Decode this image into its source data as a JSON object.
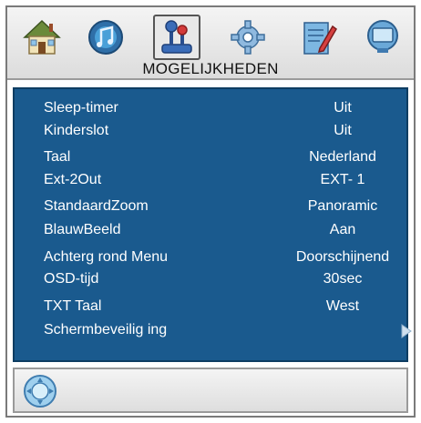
{
  "header": {
    "title": "MOGELIJKHEDEN",
    "icons": [
      {
        "name": "home-icon"
      },
      {
        "name": "sound-icon"
      },
      {
        "name": "options-joystick-icon",
        "selected": true
      },
      {
        "name": "settings-gear-icon"
      },
      {
        "name": "edit-notepad-icon"
      },
      {
        "name": "source-monitor-icon"
      }
    ]
  },
  "settings": {
    "rows": [
      {
        "label": "Sleep-timer",
        "value": "Uit"
      },
      {
        "label": "Kinderslot",
        "value": "Uit"
      },
      {
        "label": "Taal",
        "value": "Nederland"
      },
      {
        "label": "Ext-2Out",
        "value": "EXT- 1"
      },
      {
        "label": "StandaardZoom",
        "value": "Panoramic"
      },
      {
        "label": "BlauwBeeld",
        "value": "Aan"
      },
      {
        "label": "Achterg rond Menu",
        "value": "Doorschijnend"
      },
      {
        "label": "OSD-tijd",
        "value": "30sec"
      },
      {
        "label": "TXT Taal",
        "value": "West"
      },
      {
        "label": "Schermbeveilig ing",
        "value": ""
      }
    ]
  },
  "footer": {
    "icon": "navigation-circle-icon"
  },
  "colors": {
    "panel_bg": "#1a5a8e",
    "panel_text": "#ffffff",
    "arrow": "#cfe0ee"
  }
}
